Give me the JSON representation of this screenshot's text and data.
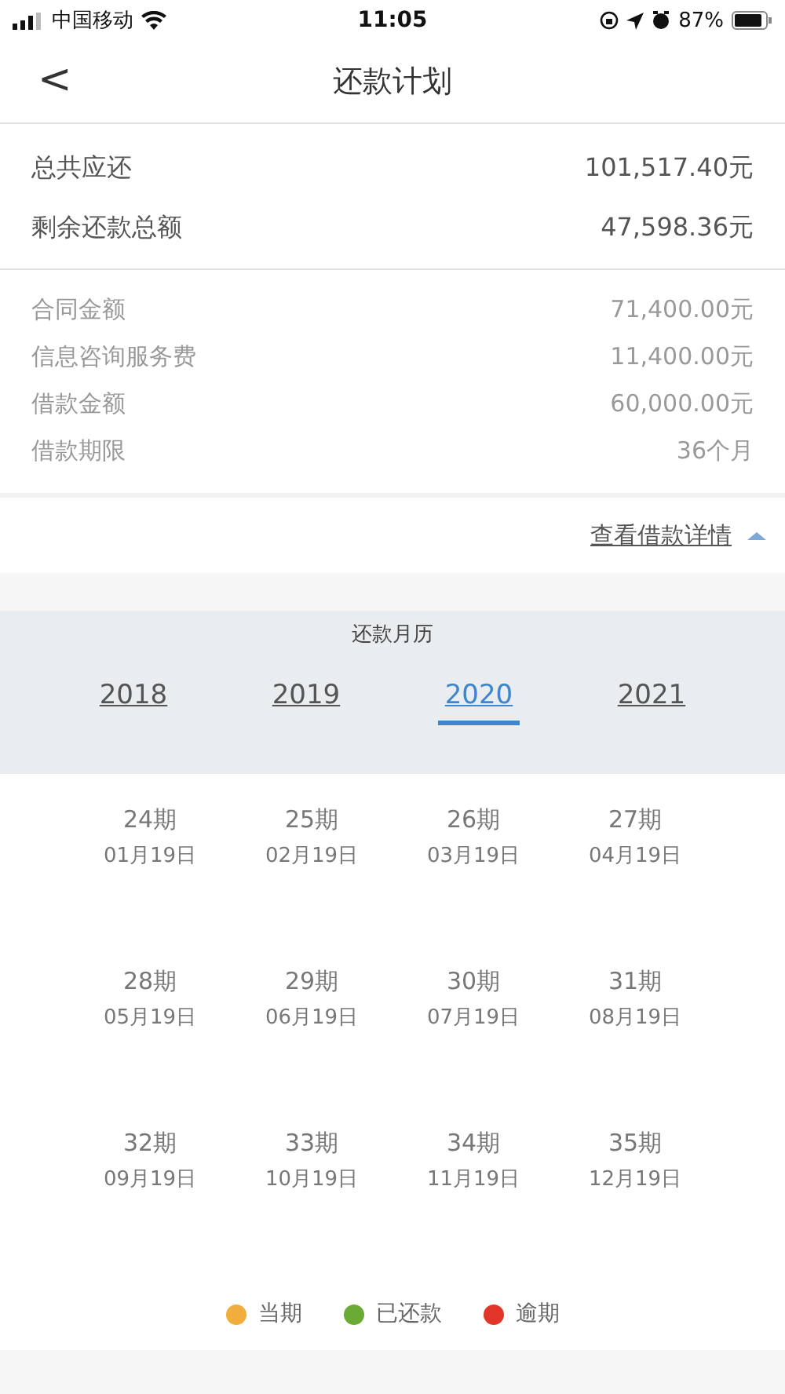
{
  "status_bar": {
    "carrier": "中国移动",
    "time": "11:05",
    "battery": "87%"
  },
  "nav": {
    "back": "<",
    "title": "还款计划"
  },
  "summary": [
    {
      "label": "总共应还",
      "value": "101,517.40元"
    },
    {
      "label": "剩余还款总额",
      "value": "47,598.36元"
    }
  ],
  "details": [
    {
      "label": "合同金额",
      "value": "71,400.00元"
    },
    {
      "label": "信息咨询服务费",
      "value": "11,400.00元"
    },
    {
      "label": "借款金额",
      "value": "60,000.00元"
    },
    {
      "label": "借款期限",
      "value": "36个月"
    }
  ],
  "details_link": "查看借款详情",
  "calendar": {
    "title": "还款月历",
    "years": [
      {
        "label": "2018",
        "selected": false
      },
      {
        "label": "2019",
        "selected": false
      },
      {
        "label": "2020",
        "selected": true
      },
      {
        "label": "2021",
        "selected": false
      }
    ],
    "installments": [
      {
        "period": "24期",
        "date": "01月19日"
      },
      {
        "period": "25期",
        "date": "02月19日"
      },
      {
        "period": "26期",
        "date": "03月19日"
      },
      {
        "period": "27期",
        "date": "04月19日"
      },
      {
        "period": "28期",
        "date": "05月19日"
      },
      {
        "period": "29期",
        "date": "06月19日"
      },
      {
        "period": "30期",
        "date": "07月19日"
      },
      {
        "period": "31期",
        "date": "08月19日"
      },
      {
        "period": "32期",
        "date": "09月19日"
      },
      {
        "period": "33期",
        "date": "10月19日"
      },
      {
        "period": "34期",
        "date": "11月19日"
      },
      {
        "period": "35期",
        "date": "12月19日"
      }
    ],
    "legend": [
      {
        "label": "当期",
        "color": "#f2ae3c"
      },
      {
        "label": "已还款",
        "color": "#6aaa35"
      },
      {
        "label": "逾期",
        "color": "#e3362b"
      }
    ]
  }
}
